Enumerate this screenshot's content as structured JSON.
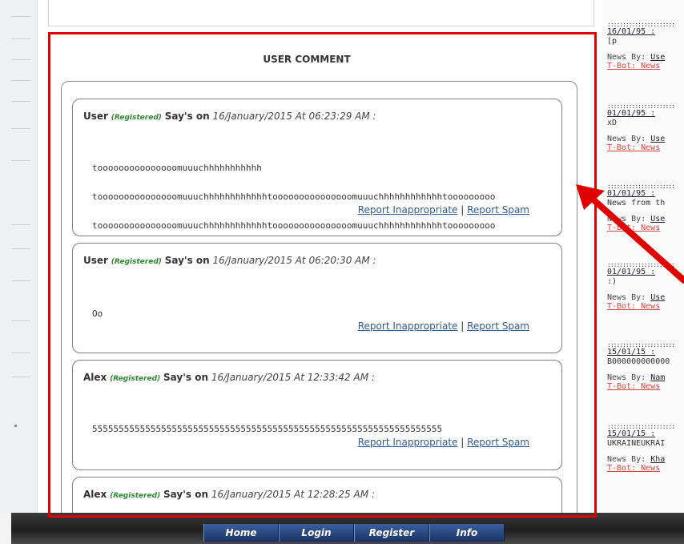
{
  "section": {
    "title": "USER COMMENT"
  },
  "comments": [
    {
      "user": "User",
      "status": "(Registered)",
      "says": "Say's on",
      "date": "16/January/2015 At 06:23:29 AM :",
      "lines": [
        "tooooooooooooooomuuuchhhhhhhhhhh",
        "tooooooooooooooomuuuchhhhhhhhhhhhtooooooooooooooomuuuchhhhhhhhhhhhtooooooooo",
        "tooooooooooooooomuuuchhhhhhhhhhhhtooooooooooooooomuuuchhhhhhhhhhhhtooooooooo"
      ],
      "report_inappropriate": "Report Inappropriate",
      "separator": "|",
      "report_spam": "Report Spam"
    },
    {
      "user": "User",
      "status": "(Registered)",
      "says": "Say's on",
      "date": "16/January/2015 At 06:20:30 AM :",
      "lines": [
        "Oo"
      ],
      "report_inappropriate": "Report Inappropriate",
      "separator": "|",
      "report_spam": "Report Spam"
    },
    {
      "user": "Alex",
      "status": "(Registered)",
      "says": "Say's on",
      "date": "16/January/2015 At 12:33:42 AM :",
      "lines": [
        "555555555555555555555555555555555555555555555555555555555555555555"
      ],
      "report_inappropriate": "Report Inappropriate",
      "separator": "|",
      "report_spam": "Report Spam"
    },
    {
      "user": "Alex",
      "status": "(Registered)",
      "says": "Say's on",
      "date": "16/January/2015 At 12:28:25 AM :"
    }
  ],
  "news": [
    {
      "date": "16/01/95 :",
      "text": "[p",
      "by_label": "News By:",
      "by_name": "Use",
      "bot": "T-Bot: News"
    },
    {
      "date": "01/01/95 :",
      "text": "xD",
      "by_label": "News By:",
      "by_name": "Use",
      "bot": "T-Bot: News"
    },
    {
      "date": "01/01/95 :",
      "text": "News from th",
      "by_label": "News By:",
      "by_name": "Use",
      "bot": "T-Bot: News"
    },
    {
      "date": "01/01/95 :",
      "text": ":)",
      "by_label": "News By:",
      "by_name": "Use",
      "bot": "T-Bot: News"
    },
    {
      "date": "15/01/15 :",
      "text": "B000000000000",
      "by_label": "News By:",
      "by_name": "Nam",
      "bot": "T-Bot: News"
    },
    {
      "date": "15/01/15 :",
      "text": "UKRAINEUKRAI",
      "by_label": "News By:",
      "by_name": "Kha",
      "bot": "T-Bot: News"
    }
  ],
  "nav": [
    "Home",
    "Login",
    "Register",
    "Info"
  ],
  "colors": {
    "highlight": "#e00000",
    "registered": "#2e8b2e",
    "link": "#2f5a9a",
    "bot_link": "#d84444",
    "nav_button": "#2a4a85"
  }
}
